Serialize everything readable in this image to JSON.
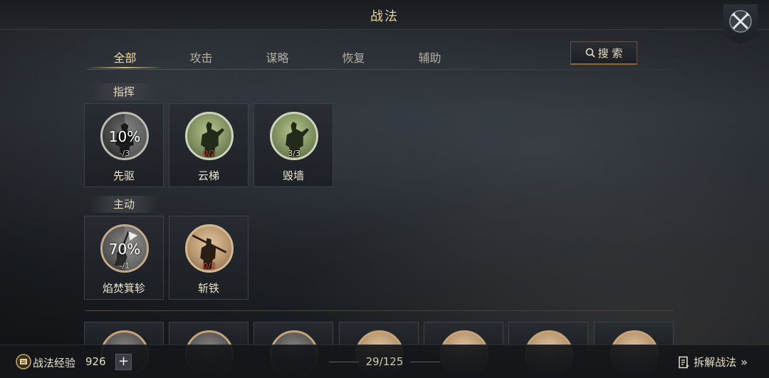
{
  "header": {
    "title": "战法"
  },
  "tabs": [
    {
      "label": "全部",
      "active": true
    },
    {
      "label": "攻击",
      "active": false
    },
    {
      "label": "谋略",
      "active": false
    },
    {
      "label": "恢复",
      "active": false
    },
    {
      "label": "辅助",
      "active": false
    }
  ],
  "search": {
    "label": "搜 索"
  },
  "sections": [
    {
      "title": "指挥",
      "cards": [
        {
          "name": "先驱",
          "percent": "10%",
          "count": "-/3",
          "icon": "soldier-icon"
        },
        {
          "name": "云梯",
          "percent": "",
          "count": "0/2",
          "icon": "soldier-icon"
        },
        {
          "name": "毁墙",
          "percent": "",
          "count": "3/3",
          "icon": "soldier-icon"
        }
      ]
    },
    {
      "title": "主动",
      "cards": [
        {
          "name": "焰焚箕轸",
          "percent": "70%",
          "count": "-/1",
          "icon": "fire-icon"
        },
        {
          "name": "斩铁",
          "percent": "",
          "count": "0/2",
          "icon": "warrior-icon"
        }
      ]
    }
  ],
  "bottom": {
    "exp_label": "战法经验",
    "exp_value": "926",
    "plus_label": "+",
    "page": "29/125",
    "disassemble_label": "拆解战法",
    "disassemble_chevron": "»"
  },
  "colors": {
    "accent": "#f0d79b",
    "count_red": "#c8473a"
  }
}
